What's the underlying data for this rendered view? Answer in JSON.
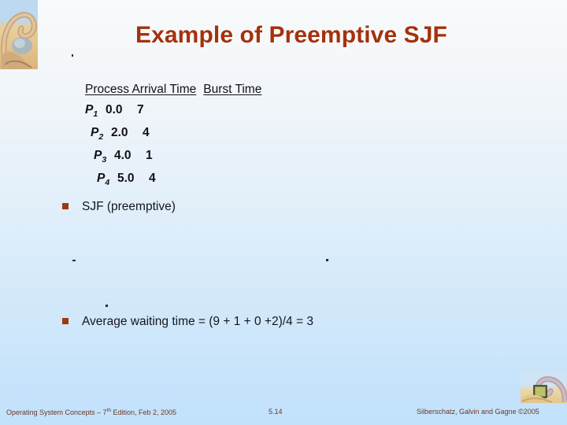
{
  "slide": {
    "title": "Example of Preemptive SJF",
    "accent_color": "#a5310d",
    "bullet_color": "#9c3a12",
    "background_top_color": "#f8fafb",
    "background_bottom_color": "#c2e1fb"
  },
  "table": {
    "header": {
      "group_one": "Process Arrival Time",
      "group_two": "Burst Time"
    },
    "columns": [
      "Process",
      "Arrival Time",
      "Burst Time"
    ],
    "rows": [
      {
        "process": "P",
        "index": "1",
        "arrival": "0.0",
        "burst": "7"
      },
      {
        "process": "P",
        "index": "2",
        "arrival": "2.0",
        "burst": "4"
      },
      {
        "process": "P",
        "index": "3",
        "arrival": "4.0",
        "burst": "1"
      },
      {
        "process": "P",
        "index": "4",
        "arrival": "5.0",
        "burst": "4"
      }
    ]
  },
  "bullets": {
    "sjf": "SJF (preemptive)",
    "average_waiting_time": "Average waiting time = (9 + 1 + 0 +2)/4 = 3"
  },
  "footer": {
    "left_prefix": "Operating System Concepts – 7",
    "left_sup": "th",
    "left_suffix": " Edition, Feb 2, 2005",
    "page": "5.14",
    "right": "Silberschatz, Galvin and Gagne ©2005"
  },
  "images": {
    "top_left": "dinosaur-illustration",
    "bottom_right": "dinosaur-illustration"
  }
}
